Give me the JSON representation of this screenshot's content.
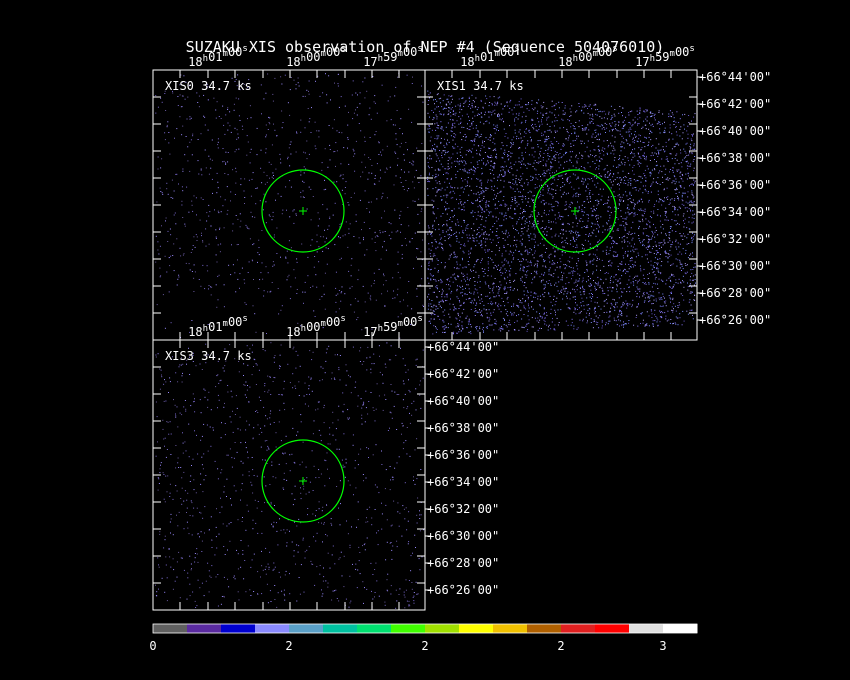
{
  "title": "SUZAKU XIS observation of NEP #4  (Sequence 504076010)",
  "ra_ticks": [
    {
      "h": "18",
      "m": "01",
      "s": "00"
    },
    {
      "h": "18",
      "m": "00",
      "s": "00"
    },
    {
      "h": "17",
      "m": "59",
      "s": "00"
    }
  ],
  "dec_ticks": [
    "+66°44'00\"",
    "+66°42'00\"",
    "+66°40'00\"",
    "+66°38'00\"",
    "+66°36'00\"",
    "+66°34'00\"",
    "+66°32'00\"",
    "+66°30'00\"",
    "+66°28'00\"",
    "+66°26'00\""
  ],
  "panels": [
    {
      "id": "xis0",
      "label": "XIS0 34.7 ks",
      "density": "low"
    },
    {
      "id": "xis1",
      "label": "XIS1 34.7 ks",
      "density": "high"
    },
    {
      "id": "xis3",
      "label": "XIS3 34.7 ks",
      "density": "low"
    }
  ],
  "source_marker": {
    "shape": "circle",
    "color": "#00ff00"
  },
  "colorbar": {
    "colors": [
      "#606060",
      "#5a2aa0",
      "#0000d0",
      "#8a8aff",
      "#5aa0c8",
      "#00c0a0",
      "#00e070",
      "#40ff00",
      "#a0e000",
      "#ffff00",
      "#f0c000",
      "#b06000",
      "#e02020",
      "#ff0000",
      "#e0e0e0",
      "#ffffff"
    ],
    "tick_labels": [
      "0",
      "2",
      "2",
      "2",
      "3"
    ]
  }
}
